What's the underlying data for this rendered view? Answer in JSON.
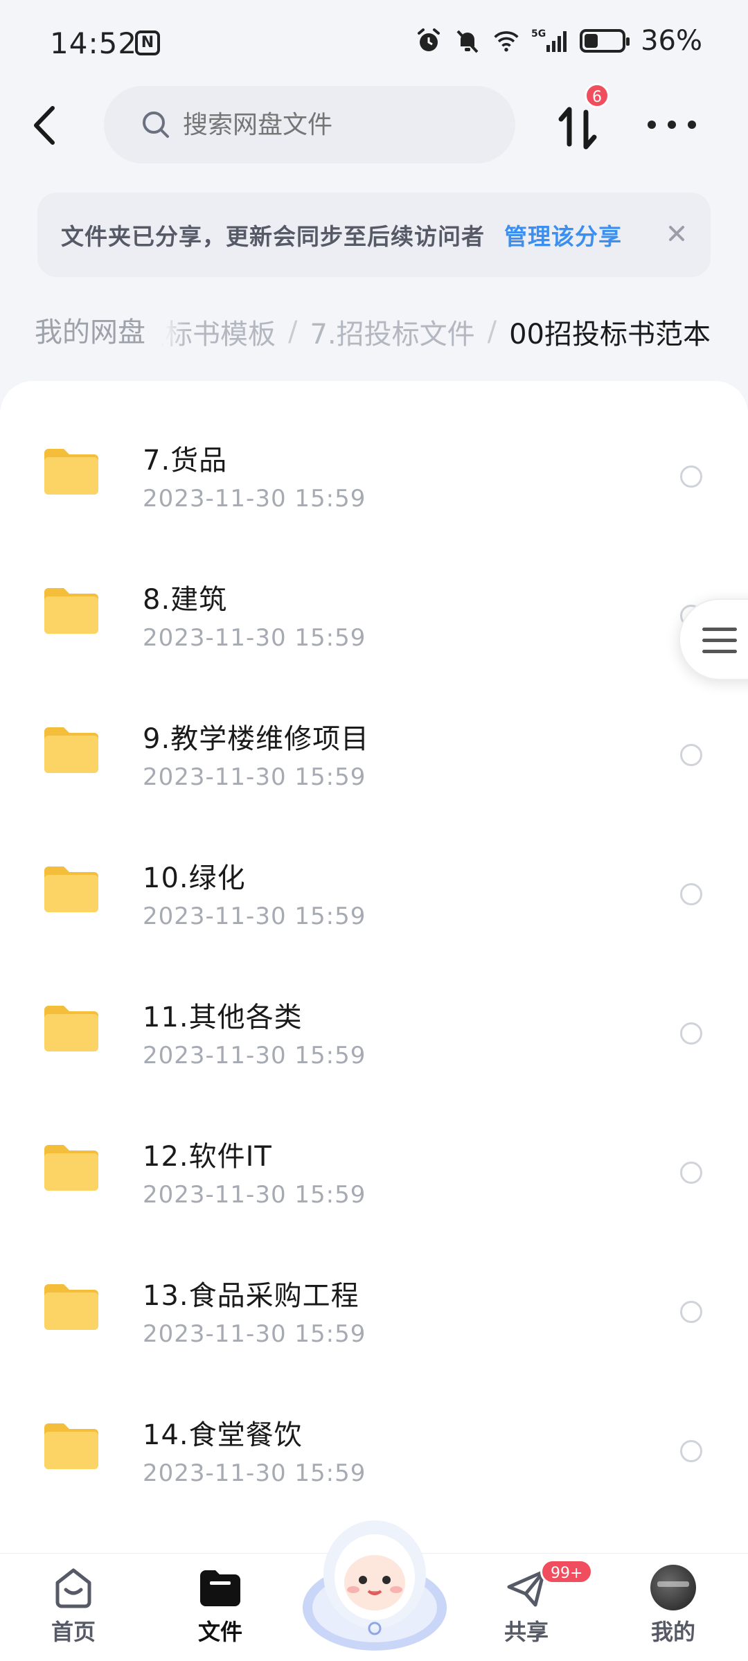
{
  "status_bar": {
    "time": "14:52",
    "network": "5G",
    "battery_percent": "36%",
    "battery_level": 0.36
  },
  "top_bar": {
    "search_placeholder": "搜索网盘文件",
    "transfer_badge": "6"
  },
  "notice": {
    "text": "文件夹已分享，更新会同步至后续访问者",
    "link": "管理该分享"
  },
  "breadcrumb": {
    "root": "我的网盘",
    "items": [
      "招投标书模板",
      "7.招投标文件",
      "00招投标书范本"
    ]
  },
  "files": [
    {
      "name": "7.货品",
      "date": "2023-11-30  15:59"
    },
    {
      "name": "8.建筑",
      "date": "2023-11-30  15:59"
    },
    {
      "name": "9.教学楼维修项目",
      "date": "2023-11-30  15:59"
    },
    {
      "name": "10.绿化",
      "date": "2023-11-30  15:59"
    },
    {
      "name": "11.其他各类",
      "date": "2023-11-30  15:59"
    },
    {
      "name": "12.软件IT",
      "date": "2023-11-30  15:59"
    },
    {
      "name": "13.食品采购工程",
      "date": "2023-11-30  15:59"
    },
    {
      "name": "14.食堂餐饮",
      "date": "2023-11-30  15:59"
    }
  ],
  "bottom_nav": {
    "home": "首页",
    "files": "文件",
    "share": "共享",
    "share_badge": "99+",
    "me": "我的"
  },
  "colors": {
    "accent": "#3a8ff0",
    "badge": "#f04d5e",
    "folder": "#f7c948"
  }
}
